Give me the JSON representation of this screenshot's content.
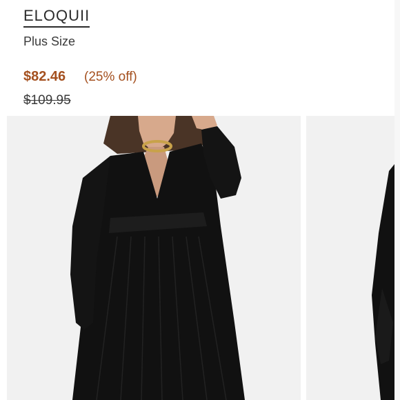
{
  "product": {
    "brand": "ELOQUII",
    "size_label": "Plus Size",
    "price": "$82.46",
    "discount": "(25% off)",
    "original_price": "$109.95"
  },
  "colors": {
    "price_accent": "#a4501f",
    "text": "#2b2b2b",
    "dress": "#111111",
    "photo_bg": "#f1f1f1"
  }
}
